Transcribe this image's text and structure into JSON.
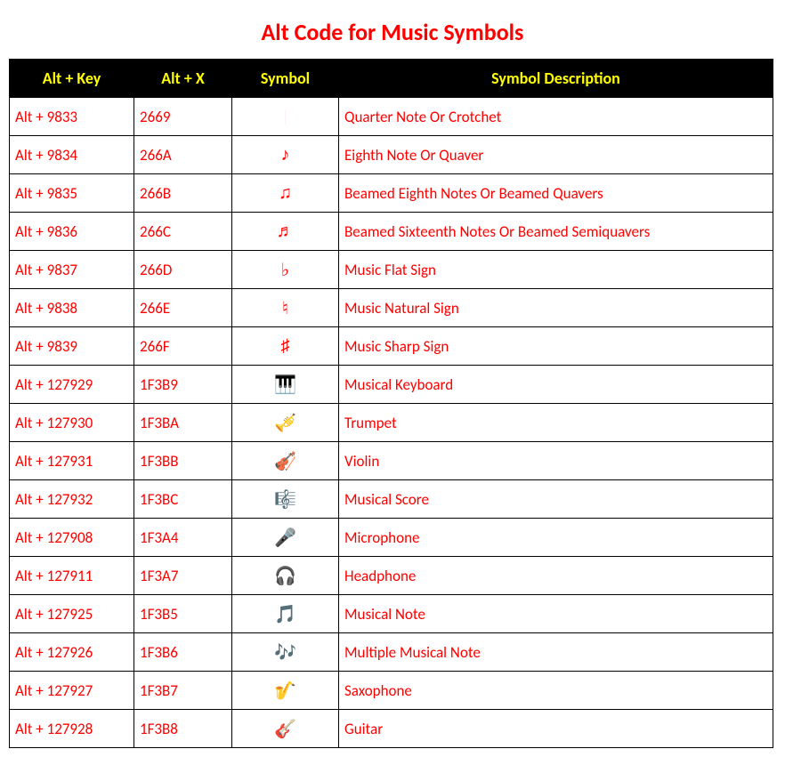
{
  "title": "Alt Code for Music Symbols",
  "headers": {
    "alt_key": "Alt + Key",
    "alt_x": "Alt + X",
    "symbol": "Symbol",
    "description": "Symbol Description"
  },
  "rows": [
    {
      "alt_key": "Alt + 9833",
      "alt_x": "2669",
      "symbol": "♩",
      "description": "Quarter Note Or Crotchet"
    },
    {
      "alt_key": "Alt + 9834",
      "alt_x": "266A",
      "symbol": "♪",
      "description": "Eighth Note Or Quaver"
    },
    {
      "alt_key": "Alt + 9835",
      "alt_x": "266B",
      "symbol": "♫",
      "description": "Beamed Eighth Notes Or Beamed Quavers"
    },
    {
      "alt_key": "Alt + 9836",
      "alt_x": "266C",
      "symbol": "♬",
      "description": "Beamed Sixteenth Notes Or Beamed Semiquavers"
    },
    {
      "alt_key": "Alt + 9837",
      "alt_x": "266D",
      "symbol": "♭",
      "description": "Music Flat Sign"
    },
    {
      "alt_key": "Alt + 9838",
      "alt_x": "266E",
      "symbol": "♮",
      "description": "Music Natural Sign"
    },
    {
      "alt_key": "Alt + 9839",
      "alt_x": "266F",
      "symbol": "♯",
      "description": "Music Sharp Sign"
    },
    {
      "alt_key": "Alt + 127929",
      "alt_x": "1F3B9",
      "symbol": "🎹",
      "description": "Musical Keyboard"
    },
    {
      "alt_key": "Alt + 127930",
      "alt_x": "1F3BA",
      "symbol": "🎺",
      "description": "Trumpet"
    },
    {
      "alt_key": "Alt + 127931",
      "alt_x": "1F3BB",
      "symbol": "🎻",
      "description": "Violin"
    },
    {
      "alt_key": "Alt + 127932",
      "alt_x": "1F3BC",
      "symbol": "🎼",
      "description": "Musical Score"
    },
    {
      "alt_key": "Alt + 127908",
      "alt_x": "1F3A4",
      "symbol": "🎤",
      "description": "Microphone"
    },
    {
      "alt_key": "Alt + 127911",
      "alt_x": "1F3A7",
      "symbol": "🎧",
      "description": "Headphone"
    },
    {
      "alt_key": "Alt + 127925",
      "alt_x": "1F3B5",
      "symbol": "🎵",
      "description": "Musical Note"
    },
    {
      "alt_key": "Alt + 127926",
      "alt_x": "1F3B6",
      "symbol": "🎶",
      "description": "Multiple Musical Note"
    },
    {
      "alt_key": "Alt + 127927",
      "alt_x": "1F3B7",
      "symbol": "🎷",
      "description": "Saxophone"
    },
    {
      "alt_key": "Alt + 127928",
      "alt_x": "1F3B8",
      "symbol": "🎸",
      "description": "Guitar"
    }
  ]
}
